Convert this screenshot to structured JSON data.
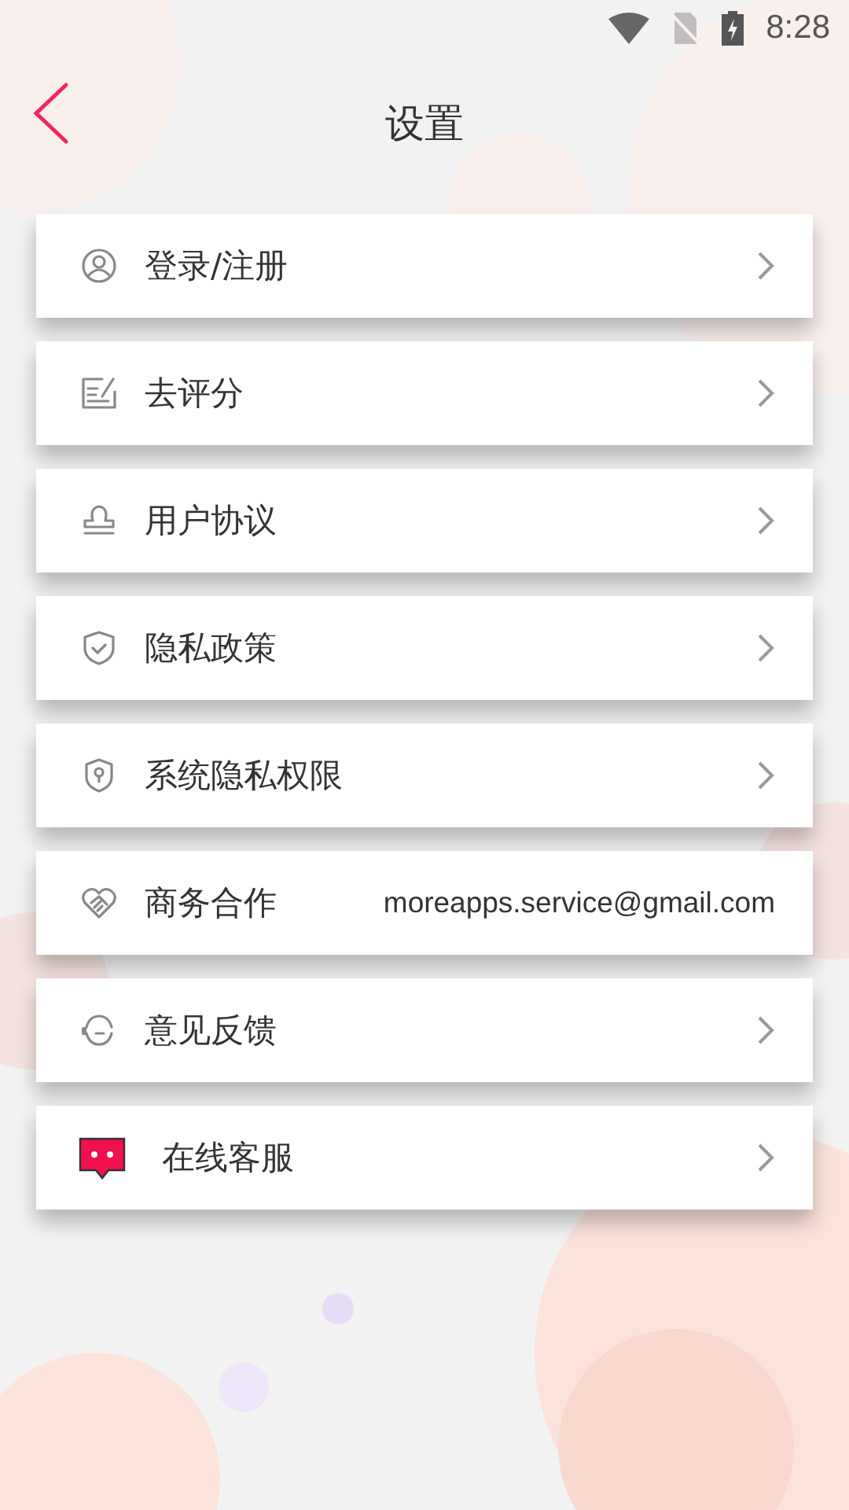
{
  "status_bar": {
    "time": "8:28"
  },
  "header": {
    "title": "设置"
  },
  "items": [
    {
      "kind": "user",
      "label": "登录/注册"
    },
    {
      "kind": "rate",
      "label": "去评分"
    },
    {
      "kind": "stamp",
      "label": "用户协议"
    },
    {
      "kind": "shield",
      "label": "隐私政策"
    },
    {
      "kind": "shield-key",
      "label": "系统隐私权限"
    },
    {
      "kind": "handshake",
      "label": "商务合作",
      "value": "moreapps.service@gmail.com"
    },
    {
      "kind": "headset",
      "label": "意见反馈"
    },
    {
      "kind": "chat",
      "label": "在线客服"
    }
  ]
}
